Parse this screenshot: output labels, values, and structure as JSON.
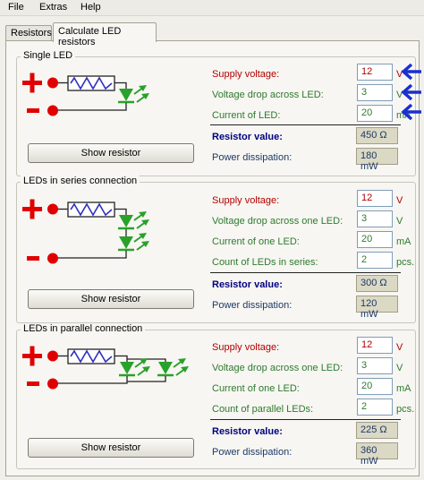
{
  "menu": {
    "file": "File",
    "extras": "Extras",
    "help": "Help"
  },
  "tabs": [
    {
      "label": "Resistors"
    },
    {
      "label": "Calculate LED resistors"
    }
  ],
  "groups": {
    "single": {
      "title": "Single LED",
      "supply_label": "Supply voltage:",
      "supply_value": "12",
      "supply_unit": "V",
      "drop_label": "Voltage drop across LED:",
      "drop_value": "3",
      "drop_unit": "V",
      "current_label": "Current of LED:",
      "current_value": "20",
      "current_unit": "mA",
      "resistor_label": "Resistor value:",
      "resistor_value": "450 Ω",
      "power_label": "Power dissipation:",
      "power_value": "180 mW",
      "button": "Show resistor"
    },
    "series": {
      "title": "LEDs in series connection",
      "supply_label": "Supply voltage:",
      "supply_value": "12",
      "supply_unit": "V",
      "drop_label": "Voltage drop across one LED:",
      "drop_value": "3",
      "drop_unit": "V",
      "current_label": "Current of one LED:",
      "current_value": "20",
      "current_unit": "mA",
      "count_label": "Count of LEDs in series:",
      "count_value": "2",
      "count_unit": "pcs.",
      "resistor_label": "Resistor value:",
      "resistor_value": "300 Ω",
      "power_label": "Power dissipation:",
      "power_value": "120 mW",
      "button": "Show resistor"
    },
    "parallel": {
      "title": "LEDs in parallel connection",
      "supply_label": "Supply voltage:",
      "supply_value": "12",
      "supply_unit": "V",
      "drop_label": "Voltage drop across one LED:",
      "drop_value": "3",
      "drop_unit": "V",
      "current_label": "Current of one LED:",
      "current_value": "20",
      "current_unit": "mA",
      "count_label": "Count of parallel LEDs:",
      "count_value": "2",
      "count_unit": "pcs.",
      "resistor_label": "Resistor value:",
      "resistor_value": "225 Ω",
      "power_label": "Power dissipation:",
      "power_value": "360 mW",
      "button": "Show resistor"
    }
  },
  "colors": {
    "input_red": "#b30000",
    "input_green": "#2f7a2f",
    "result_blue": "#000080",
    "annotation_arrow": "#1a2fd0",
    "led_green": "#2aa12a",
    "terminal_red": "#e00000"
  },
  "icons": [
    "plus-terminal-icon",
    "minus-terminal-icon",
    "resistor-icon",
    "led-icon",
    "annotation-arrow-icon"
  ]
}
